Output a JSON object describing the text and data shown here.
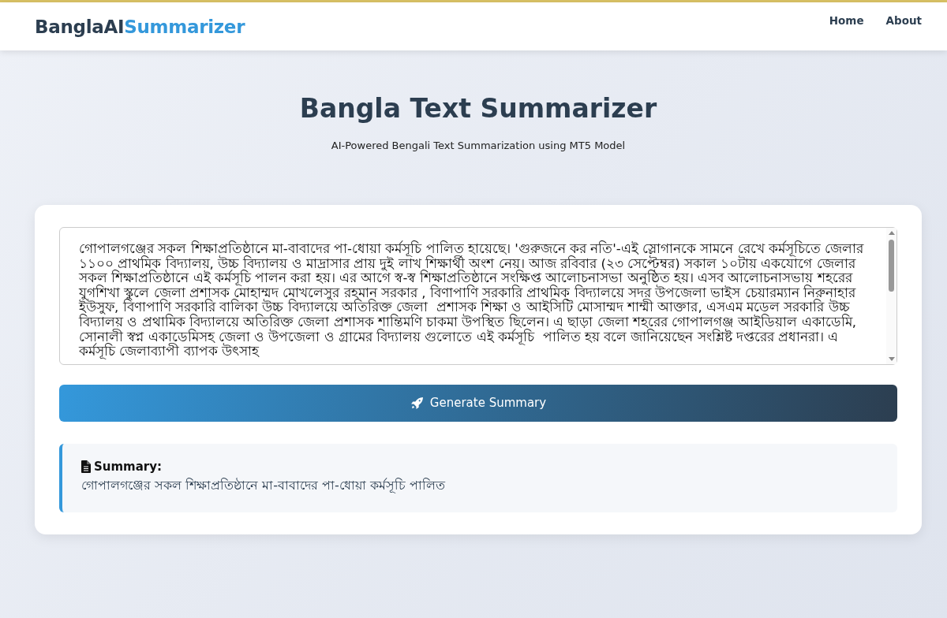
{
  "navbar": {
    "brand": {
      "first": "BanglaAI",
      "second": "Summarizer"
    },
    "links": [
      {
        "label": "Home"
      },
      {
        "label": "About"
      }
    ]
  },
  "hero": {
    "title": "Bangla Text Summarizer",
    "subtitle": "AI-Powered Bengali Text Summarization using MT5 Model"
  },
  "input": {
    "value": "গোপালগঞ্জের সকল শিক্ষাপ্রতিষ্ঠানে মা-বাবাদের পা-ধোয়া কর্মসূচি পালিত হায়েছে। 'গুরুজনে কর নতি'-এই স্লোগানকে সামনে রেখে কর্মসূচিতে জেলার ১১০০ প্রাথমিক বিদ্যালয়, উচ্চ বিদ্যালয় ও মাদ্রাসার প্রায় দুই লাখ শিক্ষার্থী অংশ নেয়। আজ রবিবার (২৩ সেপ্টেম্বর) সকাল ১০টায় একযোগে জেলার সকল শিক্ষাপ্রতিষ্ঠানে এই কর্মসূচি পালন করা হয়। এর আগে স্ব-স্ব শিক্ষাপ্রতিষ্ঠানে সংক্ষিপ্ত আলোচনাসভা অনুষ্ঠিত হয়। এসব আলোচনাসভায় শহরের যুগশিখা স্কুলে জেলা প্রশাসক মোহাম্মদ মোখলেসুর রহমান সরকার , বিণাপাণি সরকারি প্রাথমিক বিদ্যালয়ে সদর উপজেলা ভাইস চেয়ারম্যান নিরুনাহার ইউসুফ, বিণাপাণি সরকারি বালিকা উচ্চ বিদ্যালয়ে অতিরিক্ত জেলা  প্রশাসক শিক্ষা ও আইসিটি মোসাম্মদ শাম্মী আক্তার, এসএম মডেল সরকারি উচ্চ বিদ্যালয় ও প্রথামিক বিদ্যালয়ে অতিরিক্ত জেলা প্রশাসক শান্তিমণি চাকমা উপস্থিত ছিলেন। এ ছাড়া জেলা শহরের গোপালগঞ্জ আইডিয়াল একাডেমি, সোনালী স্বপ্ন একাডেমিসহ জেলা ও উপজেলা ও গ্রামের বিদ্যালয় গুলোতে এই কর্মসূচি  পালিত হয় বলে জানিয়েছেন সংশ্লিষ্ট দপ্তরের প্রধানরা। এ কর্মসূচি জেলাব্যাপী ব্যাপক উৎসাহ"
  },
  "button": {
    "label": "Generate Summary"
  },
  "summary": {
    "heading": "Summary:",
    "text": "গোপালগঞ্জের সকল শিক্ষাপ্রতিষ্ঠানে মা-বাবাদের পা-ধোয়া কর্মসূচি পালিত"
  }
}
